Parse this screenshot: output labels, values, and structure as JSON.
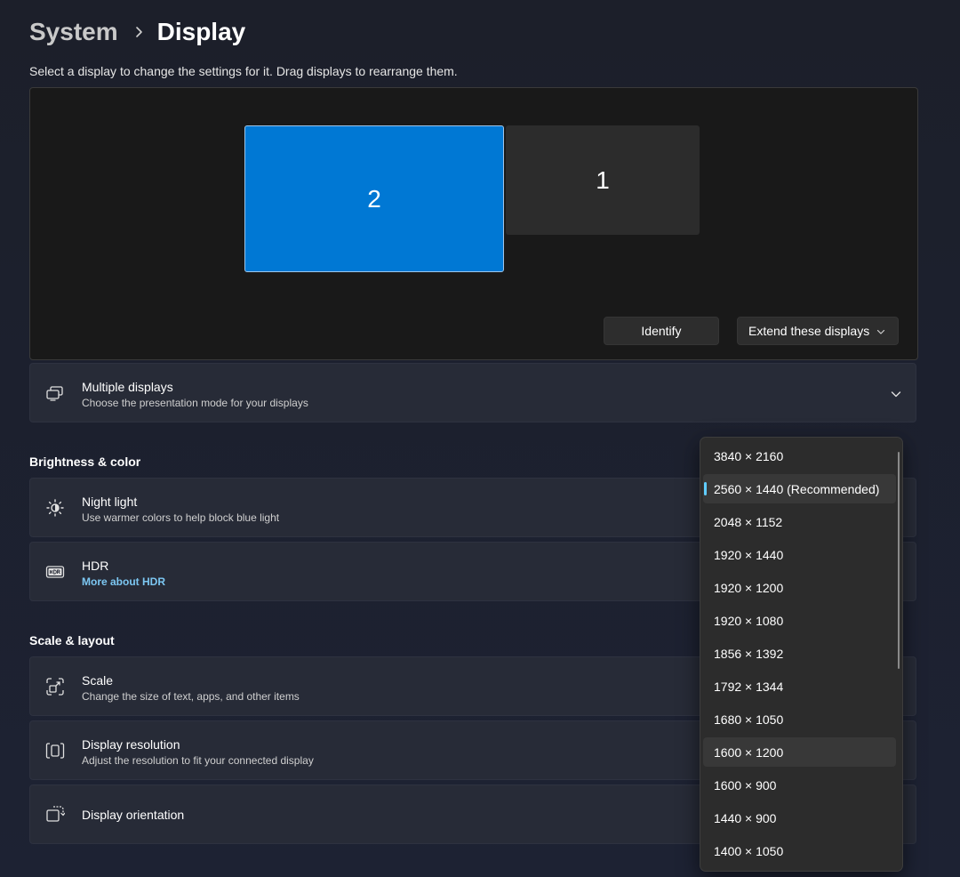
{
  "breadcrumb": {
    "parent": "System",
    "current": "Display"
  },
  "instruction": "Select a display to change the settings for it. Drag displays to rearrange them.",
  "arrangement": {
    "monitors": [
      {
        "label": "2",
        "selected": true
      },
      {
        "label": "1",
        "selected": false
      }
    ],
    "identify_label": "Identify",
    "mode_label": "Extend these displays"
  },
  "multiple_displays": {
    "title": "Multiple displays",
    "subtitle": "Choose the presentation mode for your displays",
    "icon": "multiple-displays-icon"
  },
  "brightness_section": {
    "heading": "Brightness & color",
    "night_light": {
      "title": "Night light",
      "subtitle": "Use warmer colors to help block blue light",
      "icon": "brightness-icon"
    },
    "hdr": {
      "title": "HDR",
      "link": "More about HDR",
      "icon": "hdr-icon"
    }
  },
  "scale_section": {
    "heading": "Scale & layout",
    "scale": {
      "title": "Scale",
      "subtitle": "Change the size of text, apps, and other items",
      "icon": "scale-icon"
    },
    "resolution": {
      "title": "Display resolution",
      "subtitle": "Adjust the resolution to fit your connected display",
      "icon": "resolution-icon"
    },
    "orientation": {
      "title": "Display orientation",
      "icon": "orientation-icon"
    }
  },
  "resolution_dropdown": {
    "selected_index": 1,
    "hover_index": 9,
    "options": [
      "3840 × 2160",
      "2560 × 1440 (Recommended)",
      "2048 × 1152",
      "1920 × 1440",
      "1920 × 1200",
      "1920 × 1080",
      "1856 × 1392",
      "1792 × 1344",
      "1680 × 1050",
      "1600 × 1200",
      "1600 × 900",
      "1440 × 900",
      "1400 × 1050"
    ]
  },
  "colors": {
    "accent": "#0078d4",
    "selection_indicator": "#60cdff",
    "link": "#7cc7f2"
  }
}
